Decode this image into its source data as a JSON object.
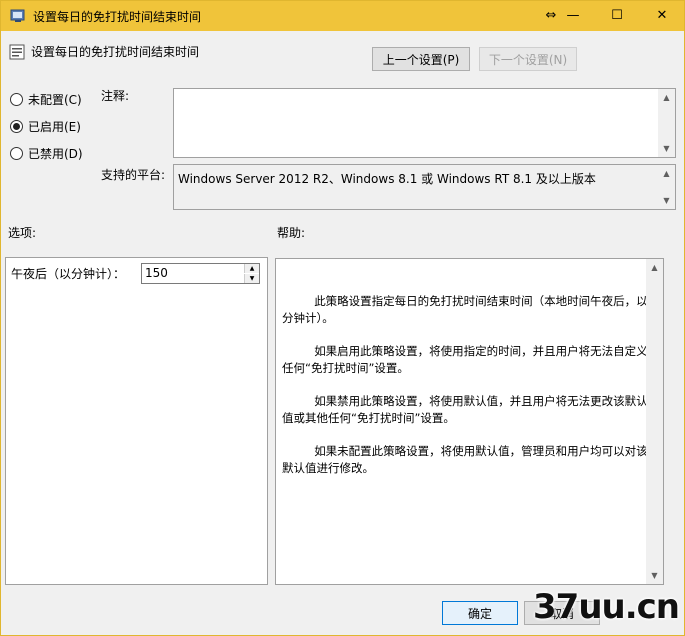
{
  "window": {
    "title": "设置每日的免打扰时间结束时间",
    "controls": {
      "restore": "⇔",
      "minimize": "—",
      "maximize": "☐",
      "close": "✕"
    }
  },
  "header": {
    "setting_name": "设置每日的免打扰时间结束时间",
    "prev_button": "上一个设置(P)",
    "next_button": "下一个设置(N)"
  },
  "state": {
    "options": [
      {
        "label": "未配置(C)",
        "selected": false
      },
      {
        "label": "已启用(E)",
        "selected": true
      },
      {
        "label": "已禁用(D)",
        "selected": false
      }
    ]
  },
  "comment": {
    "label": "注释:",
    "value": ""
  },
  "platform": {
    "label": "支持的平台:",
    "value": "Windows Server 2012 R2、Windows 8.1 或 Windows RT 8.1 及以上版本"
  },
  "options_section": {
    "label": "选项:",
    "field_label": "午夜后（以分钟计）：",
    "field_value": "150"
  },
  "help_section": {
    "label": "帮助:",
    "paragraphs": [
      "此策略设置指定每日的免打扰时间结束时间（本地时间午夜后，以分钟计）。",
      "如果启用此策略设置，将使用指定的时间，并且用户将无法自定义任何“免打扰时间”设置。",
      "如果禁用此策略设置，将使用默认值，并且用户将无法更改该默认值或其他任何“免打扰时间”设置。",
      "如果未配置此策略设置，将使用默认值，管理员和用户均可以对该默认值进行修改。"
    ]
  },
  "footer": {
    "ok_button": "确定",
    "cancel_button": "取消",
    "watermark": "37uu.cn"
  },
  "colors": {
    "titlebar": "#f0c43a",
    "window_bg": "#f0f0f0",
    "border": "#e0b62f"
  }
}
